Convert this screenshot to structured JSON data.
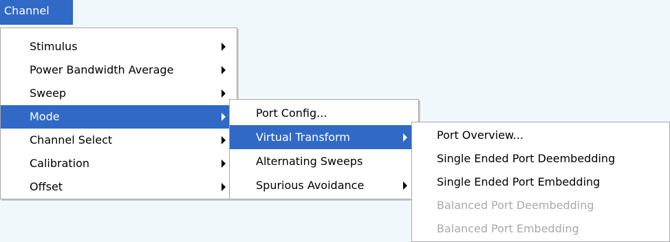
{
  "menubar": {
    "channel_label": "Channel"
  },
  "channel_menu": {
    "items": [
      {
        "label": "Stimulus"
      },
      {
        "label": "Power Bandwidth Average"
      },
      {
        "label": "Sweep"
      },
      {
        "label": "Mode"
      },
      {
        "label": "Channel Select"
      },
      {
        "label": "Calibration"
      },
      {
        "label": "Offset"
      }
    ]
  },
  "mode_menu": {
    "items": [
      {
        "label": "Port Config..."
      },
      {
        "label": "Virtual Transform"
      },
      {
        "label": "Alternating Sweeps"
      },
      {
        "label": "Spurious Avoidance"
      }
    ]
  },
  "virtual_transform_menu": {
    "items": [
      {
        "label": "Port Overview..."
      },
      {
        "label": "Single Ended Port Deembedding"
      },
      {
        "label": "Single Ended Port Embedding"
      },
      {
        "label": "Balanced Port Deembedding"
      },
      {
        "label": "Balanced Port Embedding"
      }
    ]
  },
  "colors": {
    "highlight": "#3169c6",
    "disabled_text": "#a9a9a9",
    "background": "#f1f8fc"
  }
}
